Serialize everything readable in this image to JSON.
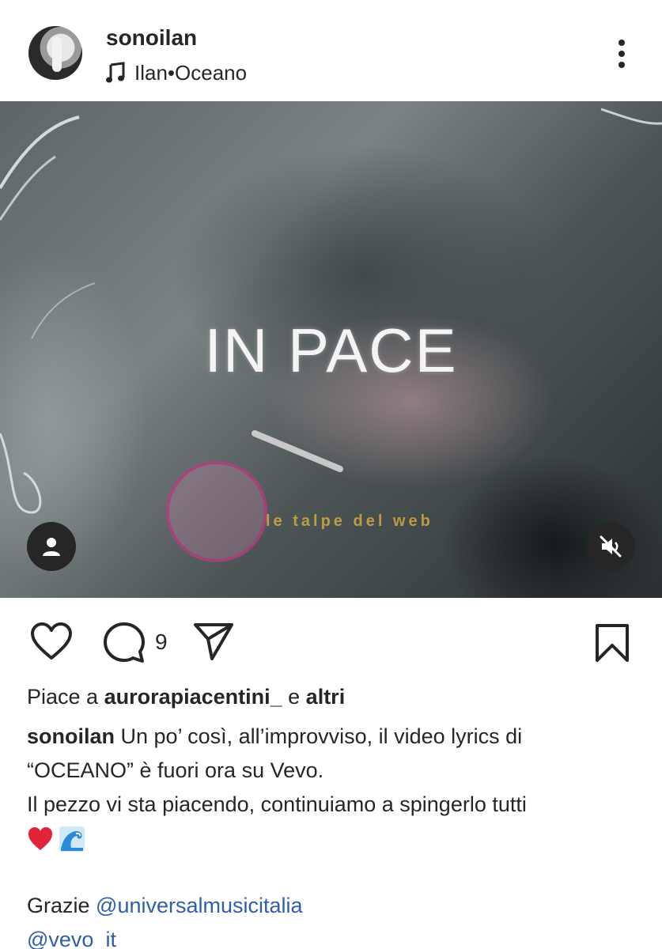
{
  "post": {
    "username": "sonoilan",
    "music": {
      "artist": "Ilan",
      "separator": " • ",
      "song": "Oceano"
    }
  },
  "media": {
    "overlay_text": "IN PACE",
    "watermark_text": "le talpe del web"
  },
  "actions": {
    "comment_count": "9"
  },
  "likes": {
    "prefix": "Piace a ",
    "user": "aurorapiacentini_",
    "middle": " e ",
    "others": "altri"
  },
  "caption": {
    "username": "sonoilan",
    "line1": " Un po’ così, all’improvviso, il video lyrics di",
    "line2": "“OCEANO” è fuori ora su Vevo.",
    "line3": "Il pezzo vi sta piacendo, continuiamo a spingerlo tutti",
    "thanks_prefix": "Grazie ",
    "mention1": "@universalmusicitalia",
    "mention2": "@vevo_it"
  },
  "icons": {
    "emoji1": "red-heart-icon",
    "emoji2": "wave-icon"
  },
  "colors": {
    "mention": "#2f5fa8",
    "text": "#262626"
  }
}
